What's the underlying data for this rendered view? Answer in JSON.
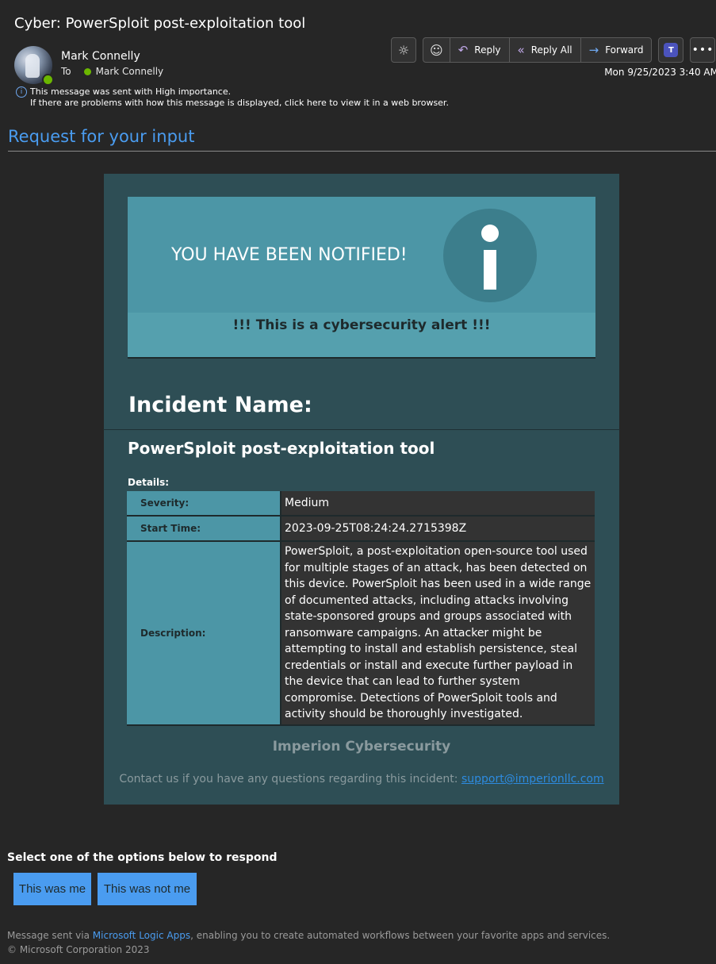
{
  "email": {
    "subject": "Cyber: PowerSploit post-exploitation tool",
    "sender": "Mark Connelly",
    "to_label": "To",
    "recipient": "Mark Connelly",
    "date": "Mon 9/25/2023 3:40 AM",
    "importance_notice": "This message was sent with High importance.",
    "browser_notice": "If there are problems with how this message is displayed, click here to view it in a web browser."
  },
  "toolbar": {
    "reply": "Reply",
    "reply_all": "Reply All",
    "forward": "Forward"
  },
  "body": {
    "heading": "Request for your input",
    "banner_text": "YOU HAVE BEEN NOTIFIED!",
    "alert_text": "!!! This is a cybersecurity alert !!!",
    "incident_label": "Incident Name:",
    "incident_title": "PowerSploit post-exploitation tool",
    "details_label": "Details:",
    "details": {
      "severity_key": "Severity:",
      "severity": "Medium",
      "start_time_key": "Start Time:",
      "start_time": "2023-09-25T08:24:24.2715398Z",
      "description_key": "Description:",
      "description": "PowerSploit, a post-exploitation open-source tool used for multiple stages of an attack, has been detected on this device. PowerSploit has been used in a wide range of documented attacks, including attacks involving state-sponsored groups and groups associated with ransomware campaigns. An attacker might be attempting to install and establish persistence, steal credentials or install and execute further payload in the device that can lead to further system compromise. Detections of PowerSploit tools and activity should be thoroughly investigated."
    },
    "brand": "Imperion Cybersecurity",
    "contact_text": "Contact us if you have any questions regarding this incident: ",
    "contact_email": "support@imperionllc.com"
  },
  "response": {
    "prompt": "Select one of the options below to respond",
    "option_a": "This was me",
    "option_b": "This was not me"
  },
  "footer": {
    "prefix": "Message sent via ",
    "link": "Microsoft Logic Apps",
    "suffix": ", enabling you to create automated workflows between your favorite apps and services.",
    "copyright": "© Microsoft Corporation 2023"
  },
  "colors": {
    "accent_blue": "#4a9cf0",
    "card_bg": "#2e4e55",
    "banner_teal": "#4c96a6",
    "presence_green": "#6bb700"
  },
  "icons": [
    "sun-icon",
    "emoji-icon",
    "reply-icon",
    "reply-all-icon",
    "forward-icon",
    "teams-icon",
    "more-icon",
    "info-icon"
  ]
}
